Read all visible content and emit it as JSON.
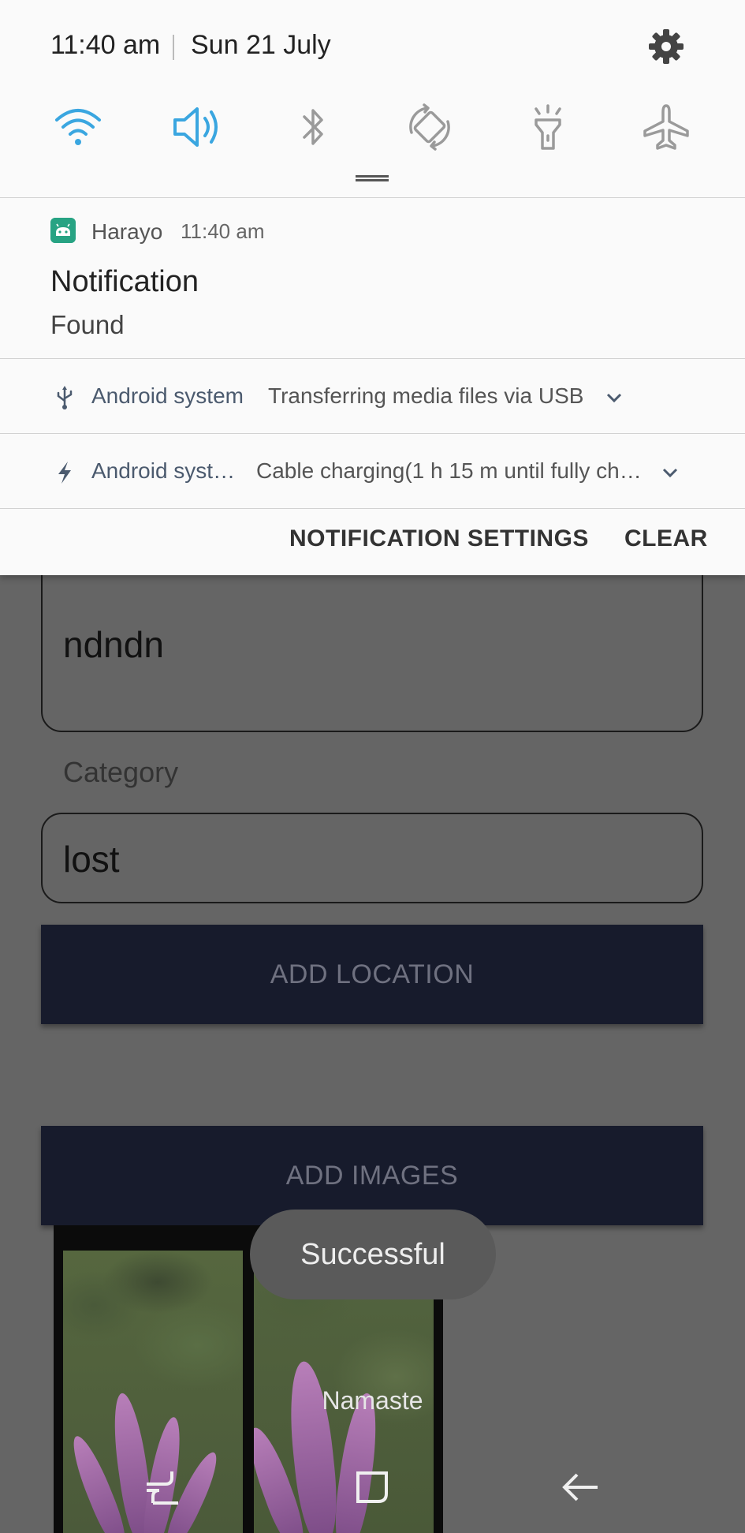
{
  "status_bar": {
    "time": "11:40 am",
    "date": "Sun 21 July"
  },
  "quick_settings": [
    {
      "icon": "wifi-icon",
      "active": true
    },
    {
      "icon": "sound-icon",
      "active": true
    },
    {
      "icon": "bluetooth-icon",
      "active": false
    },
    {
      "icon": "auto-rotate-icon",
      "active": false
    },
    {
      "icon": "flashlight-icon",
      "active": false
    },
    {
      "icon": "airplane-mode-icon",
      "active": false
    }
  ],
  "notification": {
    "app_name": "Harayo",
    "time": "11:40 am",
    "title": "Notification",
    "text": "Found"
  },
  "system_notifications": [
    {
      "app": "Android system",
      "text": "Transferring media files via USB",
      "icon": "usb-icon"
    },
    {
      "app": "Android syst…",
      "text": "Cable charging(1 h 15 m until fully ch…",
      "icon": "charging-icon"
    }
  ],
  "shade_actions": {
    "settings": "NOTIFICATION SETTINGS",
    "clear": "CLEAR"
  },
  "form": {
    "description_value": "ndndn",
    "category_label": "Category",
    "category_value": "lost",
    "add_location": "ADD LOCATION",
    "add_images": "ADD IMAGES"
  },
  "toast": "Successful",
  "overlay_caption": "Namaste",
  "colors": {
    "accent_blue": "#3aa6e0",
    "inactive_icon": "#9a9a9a",
    "button_dark": "#171b2c",
    "app_icon": "#27a383"
  }
}
